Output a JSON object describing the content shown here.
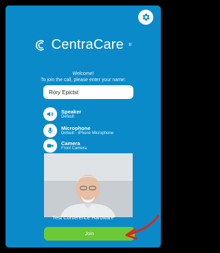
{
  "app": {
    "brand": "CentraCare",
    "brand_tm": "®"
  },
  "welcome": {
    "line1": "Welcome!",
    "line2": "To join the call, please enter your name:"
  },
  "name_input": {
    "value": "Rory Epictst"
  },
  "devices": [
    {
      "title": "Speaker",
      "subtitle": "Default",
      "icon": "speaker-icon"
    },
    {
      "title": "Microphone",
      "subtitle": "Default - iPhone Microphone",
      "icon": "microphone-icon"
    },
    {
      "title": "Camera",
      "subtitle": "Front Camera",
      "icon": "camera-icon"
    }
  ],
  "test_link": "Test Conference Hardware",
  "join_label": "Join",
  "colors": {
    "background": "#0a8ac9",
    "join_button": "#6cc936",
    "annotation_arrow": "#e0241a"
  },
  "icons": {
    "settings": "gear-icon",
    "annotation": "red-arrow-icon"
  }
}
